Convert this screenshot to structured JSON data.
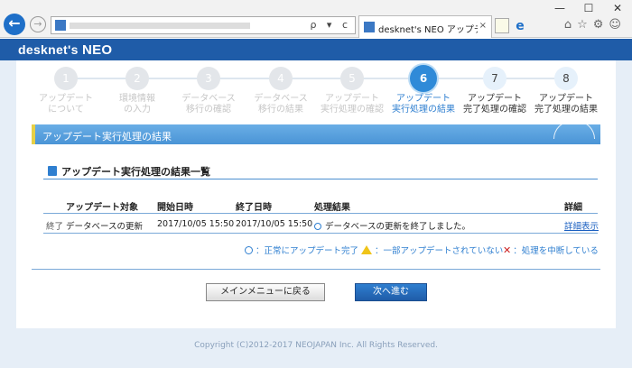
{
  "browser": {
    "tab_title": "desknet's NEO アップデートツ...",
    "tab_close": "×",
    "window_controls": [
      "—",
      "☐",
      "✕"
    ],
    "address_tools": "ρ ▾ c",
    "nav_back_icon": "arrow-left-icon",
    "nav_forward_icon": "arrow-right-icon",
    "toolbar_icons": "⌂☆⚙☺"
  },
  "app": {
    "logo_text": "desknet's",
    "logo_suffix": "NEO"
  },
  "steps": [
    {
      "num": "1",
      "label": "アップデート\nについて",
      "state": "done"
    },
    {
      "num": "2",
      "label": "環境情報\nの入力",
      "state": "done"
    },
    {
      "num": "3",
      "label": "データベース\n移行の確認",
      "state": "done"
    },
    {
      "num": "4",
      "label": "データベース\n移行の結果",
      "state": "done"
    },
    {
      "num": "5",
      "label": "アップデート\n実行処理の確認",
      "state": "done"
    },
    {
      "num": "6",
      "label": "アップデート\n実行処理の結果",
      "state": "current"
    },
    {
      "num": "7",
      "label": "アップデート\n完了処理の確認",
      "state": "next"
    },
    {
      "num": "8",
      "label": "アップデート\n完了処理の結果",
      "state": "next"
    }
  ],
  "section": {
    "title": "アップデート実行処理の結果"
  },
  "results": {
    "title": "アップデート実行処理の結果一覧",
    "headers": {
      "target": "アップデート対象",
      "start": "開始日時",
      "end": "終了日時",
      "result": "処理結果",
      "detail": "詳細"
    },
    "rows": [
      {
        "status": "終了",
        "target": "データベースの更新",
        "start": "2017/10/05 15:50",
        "end": "2017/10/05 15:50",
        "result": "データベースの更新を終了しました。",
        "detail": "詳細表示"
      }
    ],
    "legend": {
      "ok": "：正常にアップデート完了",
      "partial": "：一部アップデートされていない",
      "aborted": "：処理を中断している"
    }
  },
  "buttons": {
    "main_menu": "メインメニューに戻る",
    "next": "次へ進む"
  },
  "footer": {
    "copyright": "Copyright (C)2012-2017 NEOJAPAN Inc. All Rights Reserved."
  },
  "colors": {
    "header": "#1f5ca8",
    "accent": "#2f8ad8",
    "banner": "#4a94d6",
    "error": "#cc2020",
    "warning": "#f0c419"
  }
}
